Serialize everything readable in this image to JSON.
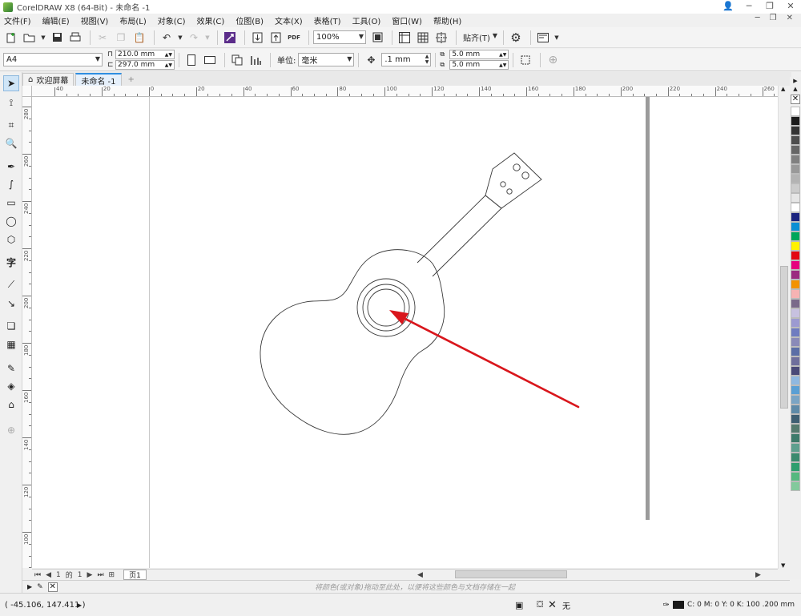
{
  "window": {
    "title": "CorelDRAW X8 (64-Bit) - 未命名 -1"
  },
  "menu": [
    "文件(F)",
    "编辑(E)",
    "视图(V)",
    "布局(L)",
    "对象(C)",
    "效果(C)",
    "位图(B)",
    "文本(X)",
    "表格(T)",
    "工具(O)",
    "窗口(W)",
    "帮助(H)"
  ],
  "toolbar": {
    "zoom_value": "100%",
    "snap_label": "贴齐(T)",
    "pdf_label": "PDF"
  },
  "propertybar": {
    "paper_size": "A4",
    "width": "210.0 mm",
    "height": "297.0 mm",
    "units_label": "单位:",
    "units_value": "毫米",
    "nudge": ".1 mm",
    "dup_x": "5.0 mm",
    "dup_y": "5.0 mm"
  },
  "tabs": [
    {
      "label": "欢迎屏幕"
    },
    {
      "label": "未命名 -1"
    }
  ],
  "ruler_h_labels": [
    "40",
    "20",
    "0",
    "20",
    "40",
    "60",
    "80",
    "100",
    "120",
    "140",
    "160",
    "180",
    "200",
    "220",
    "240",
    "260"
  ],
  "ruler_v_labels": [
    "280",
    "260",
    "240",
    "220",
    "200",
    "180",
    "160",
    "140",
    "120",
    "100"
  ],
  "pagenav": {
    "current": "1",
    "of": "的",
    "total": "1",
    "page_tab": "页1"
  },
  "hint": "将颜色(或对象)拖动至此处，以便将这些颜色与文档存储在一起",
  "status": {
    "coords": "( -45.106, 147.411 )",
    "fill_label": "无",
    "outline_label": "C: 0 M: 0 Y: 0 K: 100  .200 mm"
  },
  "palette_colors": [
    "#ffffff",
    "#1a1a1a",
    "#333333",
    "#4d4d4d",
    "#666666",
    "#808080",
    "#999999",
    "#b3b3b3",
    "#cccccc",
    "#e6e6e6",
    "#ffffff",
    "#1a237e",
    "#0b8fd3",
    "#00a65a",
    "#fff200",
    "#e30613",
    "#e6007e",
    "#9b2b80",
    "#f39200",
    "#f6b3b3",
    "#7a6a8a",
    "#c7c1e0",
    "#9c9ad1",
    "#6f7cc0",
    "#8a8ab8",
    "#5b6ea6",
    "#6f6f9c",
    "#4a4a78",
    "#8fb8e0",
    "#5a9fd4",
    "#7aa4c4",
    "#5e8aa8",
    "#3f5f73",
    "#557a6e",
    "#3d7a6a",
    "#5e9f8e",
    "#3b8a6e",
    "#2e9e6e",
    "#56b87f",
    "#83c99c"
  ],
  "colors": {
    "accent": "#2f8ee0",
    "arrow": "#d9161c",
    "guitar_stroke": "#3a3a3a"
  }
}
